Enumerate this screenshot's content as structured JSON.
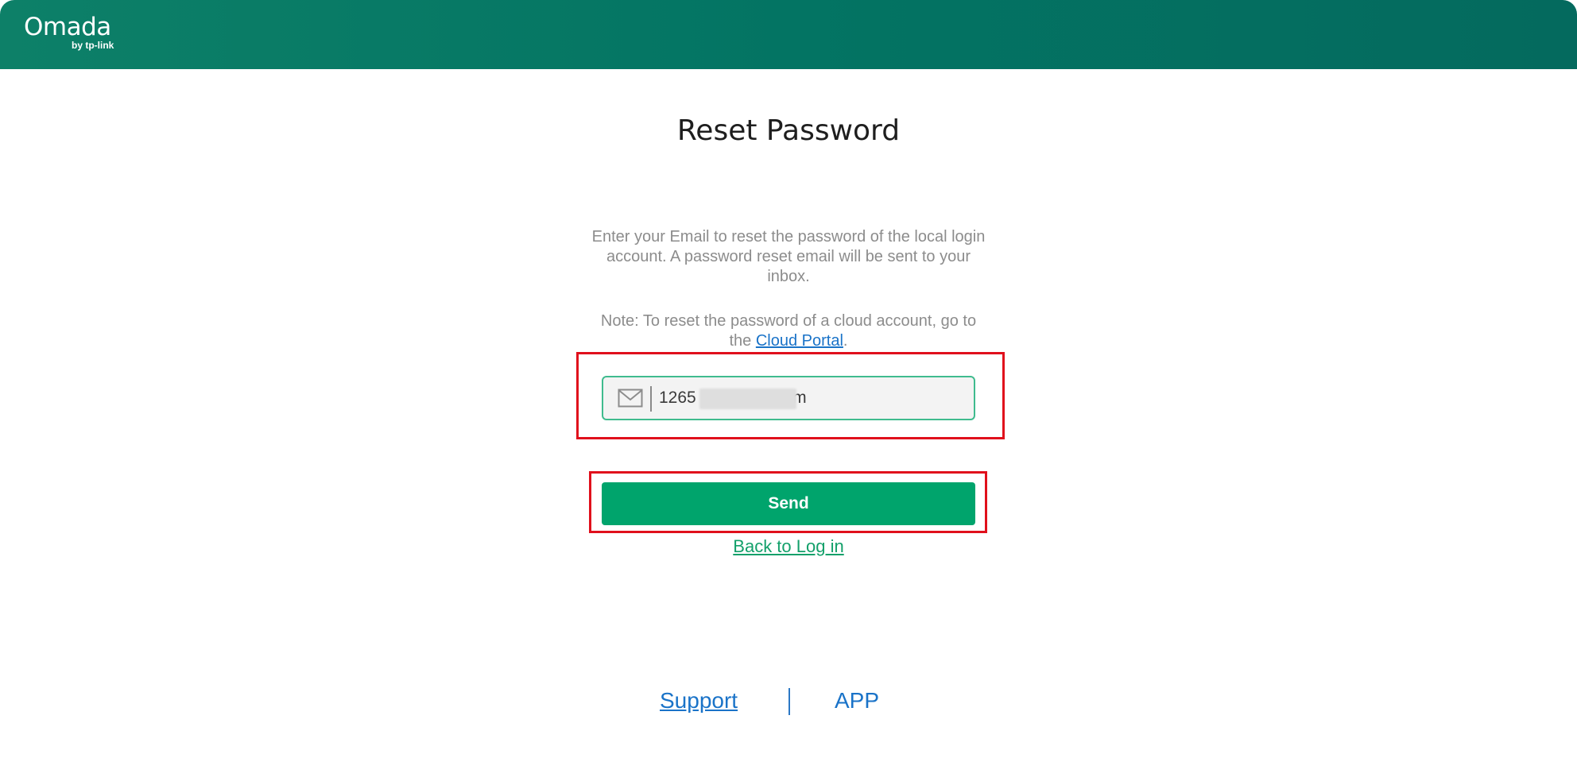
{
  "header": {
    "logo_text": "Omada",
    "logo_sub": "by tp-link"
  },
  "page": {
    "title": "Reset Password",
    "description": "Enter your Email to reset the password of the local login account. A password reset email will be sent to your inbox.",
    "note_prefix": "Note: To reset the password of a cloud account, go to the ",
    "cloud_portal_link": "Cloud Portal",
    "note_suffix": "."
  },
  "form": {
    "email_value": "1265                .com",
    "send_label": "Send",
    "back_label": "Back to Log in"
  },
  "footer": {
    "support_label": "Support",
    "app_label": "APP"
  },
  "colors": {
    "header": "#037463",
    "accent_green": "#00a46c",
    "link_blue": "#1a73c8",
    "highlight_red": "#e0101c"
  },
  "icons": {
    "email_field_icon": "mail-icon"
  }
}
